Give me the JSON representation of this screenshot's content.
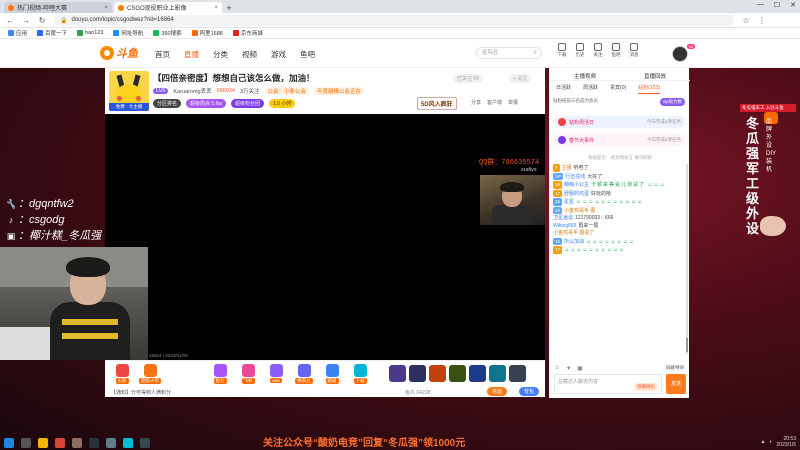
{
  "browser": {
    "tabs": [
      {
        "title": "热门视频-哔哩大赛",
        "active": false
      },
      {
        "title": "CSGO现役职业上影像",
        "active": true
      }
    ],
    "url": "douyu.com/topic/csgodwez?rid=16864",
    "bookmarks": [
      "应用",
      "百度一下",
      "hao123",
      "网址导航",
      "360搜索",
      "阿里1688",
      "京东商城"
    ]
  },
  "site": {
    "brand": "斗鱼",
    "nav": [
      "首页",
      "直播",
      "分类",
      "视频",
      "游戏",
      "鱼吧"
    ],
    "search_placeholder": "星际狂",
    "header_icons": [
      "下载",
      "历史",
      "关注",
      "鱼吧",
      "消息"
    ]
  },
  "room": {
    "avatar_badge": "免费 · 大主播",
    "title": "【四倍亲密度】想想自己该怎么做，加油！",
    "tag": "举报",
    "category": "网游竞技 > CSGO > 家常聊吧",
    "level": "LV6",
    "streamer": "Karuaromg丢丢",
    "hotness": "686034",
    "fans": "3万关注",
    "notice1": "公会：小象公会",
    "notice2": "年度巅峰公会正在",
    "pills": [
      "分区排名",
      "超级周点 5.6w",
      "超级粉丝团",
      "1.0 小时"
    ],
    "brand_logo": "5D风入疯狂",
    "ops": [
      "分享",
      "客户端",
      "举报"
    ],
    "follow_label": "+ 关注",
    "topcorner_label": "已关注 99"
  },
  "video": {
    "qq_text": "QQ群：786635574",
    "qq_sub": "sudiys",
    "stamp": "16864 | 2023/01/05"
  },
  "gifts": [
    "火箭",
    "超级火箭",
    "",
    "",
    "鱼丸",
    "飞机",
    "666",
    "佛系豆",
    "超级",
    "下载"
  ],
  "bottom": {
    "left": "【通知】分可得到人满积分",
    "mid": "鱼丸 64228",
    "btn1": "充值",
    "btn2": "背包"
  },
  "sidebar": {
    "tabs": [
      "主播视频",
      "直播回放"
    ],
    "subtabs": [
      "日活跃",
      "周活跃",
      "贵宾(0)",
      "钻粉(103)"
    ],
    "fan_badge": "vip助力数",
    "rank_text": "钻粉榜前三名成为会员",
    "banner1_title": "钻粉周活日",
    "banner1_sub": "今日完成4项任务",
    "banner2_title": "春节大事件",
    "banner2_sub": "今日完成5项任务",
    "system_msg": "系统提示：请文明发言 请勿刷屏",
    "chat": [
      {
        "lv": "7",
        "name": "主播",
        "text": "听吧了"
      },
      {
        "lv": "UP",
        "name": "行伍在线",
        "text": "大好了"
      },
      {
        "lv": "16",
        "name": "萌萌小公主",
        "text": "卡顿来等会儿测试了 ☺☺☺"
      },
      {
        "lv": "17",
        "name": "舒服的鸡蛋",
        "text": "好玩的哈"
      },
      {
        "lv": "15",
        "name": "星星",
        "text": "☺☺☺☺☺☺☺☺☺☺☺"
      },
      {
        "lv": "16",
        "name": "",
        "text": "小金鸡哥手 图"
      },
      {
        "lv": "",
        "name": "卫星逍遥",
        "text": "121790033：666"
      },
      {
        "lv": "",
        "name": "Wiking665",
        "text": "再来一局"
      },
      {
        "lv": "",
        "name": "",
        "text": "小金鸡哥手 图说了"
      },
      {
        "lv": "15",
        "name": "所以加油",
        "text": "☺☺☺☺☺☺☺☺"
      },
      {
        "lv": "17",
        "name": "",
        "text": "☺☺☺☺☺☺☺☺☺☺"
      }
    ],
    "tools_right": "屏蔽特效",
    "input_placeholder": "总藏达人聊天内容",
    "input_btn": "弹幕随机",
    "send_label": "发送"
  },
  "overlay": {
    "lines": [
      {
        "icon": "wrench-icon",
        "text": "：dgqntfw2"
      },
      {
        "icon": "music-note-icon",
        "text": "：csgodg"
      },
      {
        "icon": "bilibili-icon",
        "text": "：椰汁糕_冬瓜强"
      }
    ]
  },
  "promo_right": {
    "head": "冬瓜强军工 入驻斗鱼",
    "big": "冬瓜强军工级外设",
    "small": "品牌外设DIY装机"
  },
  "promo_bottom": "关注公众号“酸奶电竞”回复“冬瓜强”领1000元",
  "tray": {
    "time": "20:53",
    "date": "2023/1/5"
  }
}
